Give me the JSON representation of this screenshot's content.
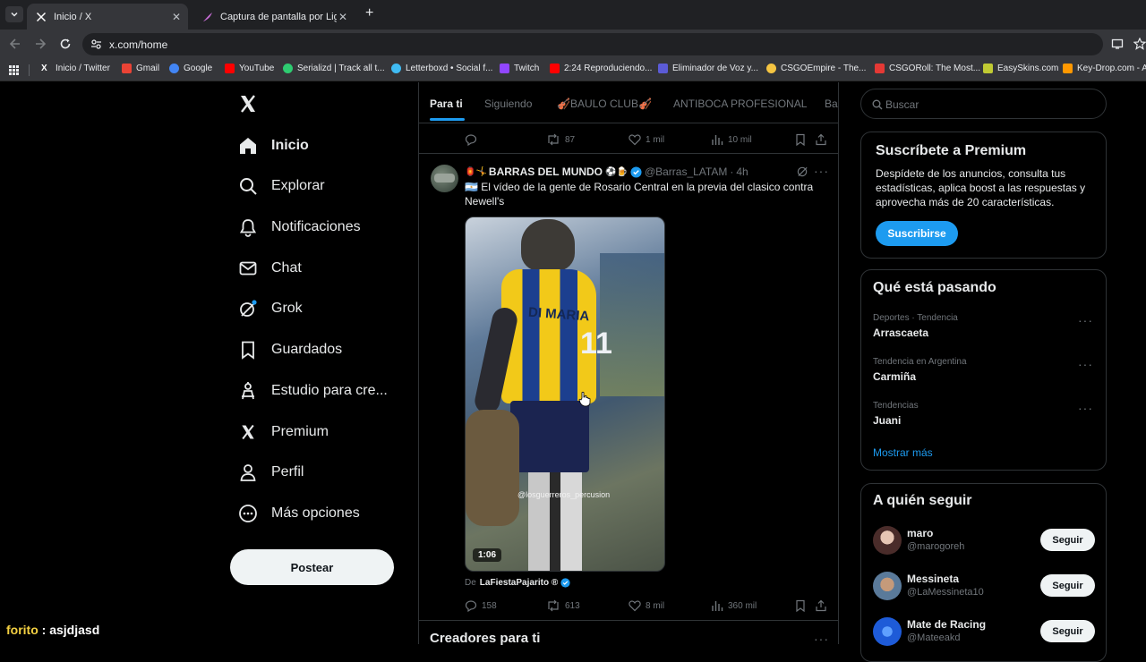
{
  "browser": {
    "tabs": [
      {
        "title": "Inicio / X",
        "active": true
      },
      {
        "title": "Captura de pantalla por Lightsh",
        "active": false
      }
    ],
    "new_tab_symbol": "+",
    "url": "x.com/home",
    "bookmarks": [
      {
        "label": "Inicio / Twitter",
        "color": "#ffffff"
      },
      {
        "label": "Gmail",
        "color": "#ea4335"
      },
      {
        "label": "Google",
        "color": "#4285f4"
      },
      {
        "label": "YouTube",
        "color": "#ff0000"
      },
      {
        "label": "Serializd | Track all t...",
        "color": "#2ecc71"
      },
      {
        "label": "Letterboxd • Social f...",
        "color": "#40bcf4"
      },
      {
        "label": "Twitch",
        "color": "#9146ff"
      },
      {
        "label": "2:24 Reproduciendo...",
        "color": "#ff0000"
      },
      {
        "label": "Eliminador de Voz y...",
        "color": "#5b5bd6"
      },
      {
        "label": "CSGOEmpire - The...",
        "color": "#f5c542"
      },
      {
        "label": "CSGORoll: The Most...",
        "color": "#e53935"
      },
      {
        "label": "EasySkins.com",
        "color": "#c0ca33"
      },
      {
        "label": "Key-Drop.com - Al",
        "color": "#ff9800"
      }
    ]
  },
  "nav": {
    "logo": "X",
    "items": [
      {
        "label": "Inicio",
        "icon": "home-icon"
      },
      {
        "label": "Explorar",
        "icon": "search-icon"
      },
      {
        "label": "Notificaciones",
        "icon": "bell-icon"
      },
      {
        "label": "Chat",
        "icon": "mail-icon"
      },
      {
        "label": "Grok",
        "icon": "grok-icon"
      },
      {
        "label": "Guardados",
        "icon": "bookmark-icon"
      },
      {
        "label": "Estudio para cre...",
        "icon": "creator-studio-icon"
      },
      {
        "label": "Premium",
        "icon": "x-logo-icon"
      },
      {
        "label": "Perfil",
        "icon": "person-icon"
      },
      {
        "label": "Más opciones",
        "icon": "more-circle-icon"
      }
    ],
    "post_button": "Postear"
  },
  "feed": {
    "tabs": [
      "Para ti",
      "Siguiendo",
      "🎻BAULO CLUB🎻",
      "ANTIBOCA PROFESIONAL",
      "Ba"
    ],
    "prev_tweet_actions": {
      "replies": "",
      "retweets": "87",
      "likes": "1 mil",
      "views": "10 mil"
    },
    "tweet": {
      "name": "BARRAS DEL MUNDO",
      "name_prefix": "🏮🤸",
      "name_suffix": "⚽🍺",
      "handle": "@Barras_LATAM",
      "time": "4h",
      "separator": "·",
      "text": "🇦🇷 El vídeo de la gente de Rosario Central en la previa del clasico contra Newell's",
      "video_duration": "1:06",
      "video_watermark": "@losguerreros_percusion",
      "shirt_name": "DI MARIA",
      "shirt_number": "11",
      "source_prefix": "De",
      "source_name": "LaFiestaPajarito ®",
      "actions": {
        "replies": "158",
        "retweets": "613",
        "likes": "8 mil",
        "views": "360 mil"
      }
    },
    "next_section_title": "Creadores para ti"
  },
  "sidebar": {
    "search_placeholder": "Buscar",
    "premium": {
      "title": "Suscríbete a Premium",
      "body": "Despídete de los anuncios, consulta tus estadísticas, aplica boost a las respuestas y aprovecha más de 20 características.",
      "button": "Suscribirse"
    },
    "trends": {
      "title": "Qué está pasando",
      "items": [
        {
          "category": "Deportes · Tendencia",
          "name": "Arrascaeta"
        },
        {
          "category": "Tendencia en Argentina",
          "name": "Carmiña"
        },
        {
          "category": "Tendencias",
          "name": "Juani"
        }
      ],
      "show_more": "Mostrar más"
    },
    "who_to_follow": {
      "title": "A quién seguir",
      "items": [
        {
          "name": "maro",
          "handle": "@marogoreh",
          "button": "Seguir",
          "avatar_color": "#8a5a4a"
        },
        {
          "name": "Messineta",
          "handle": "@LaMessineta10",
          "button": "Seguir",
          "avatar_color": "#b08968"
        },
        {
          "name": "Mate de Racing",
          "handle": "@Mateeakd",
          "button": "Seguir",
          "avatar_color": "#1e5bd8"
        }
      ]
    }
  },
  "overlay": {
    "chat_user": "forito",
    "chat_sep": ":",
    "chat_text": "asjdjasd"
  },
  "colors": {
    "accent": "#1d9bf0",
    "background": "#000000",
    "text_secondary": "#71767b",
    "border": "#2f3336",
    "overlay_user": "#f5d142"
  }
}
